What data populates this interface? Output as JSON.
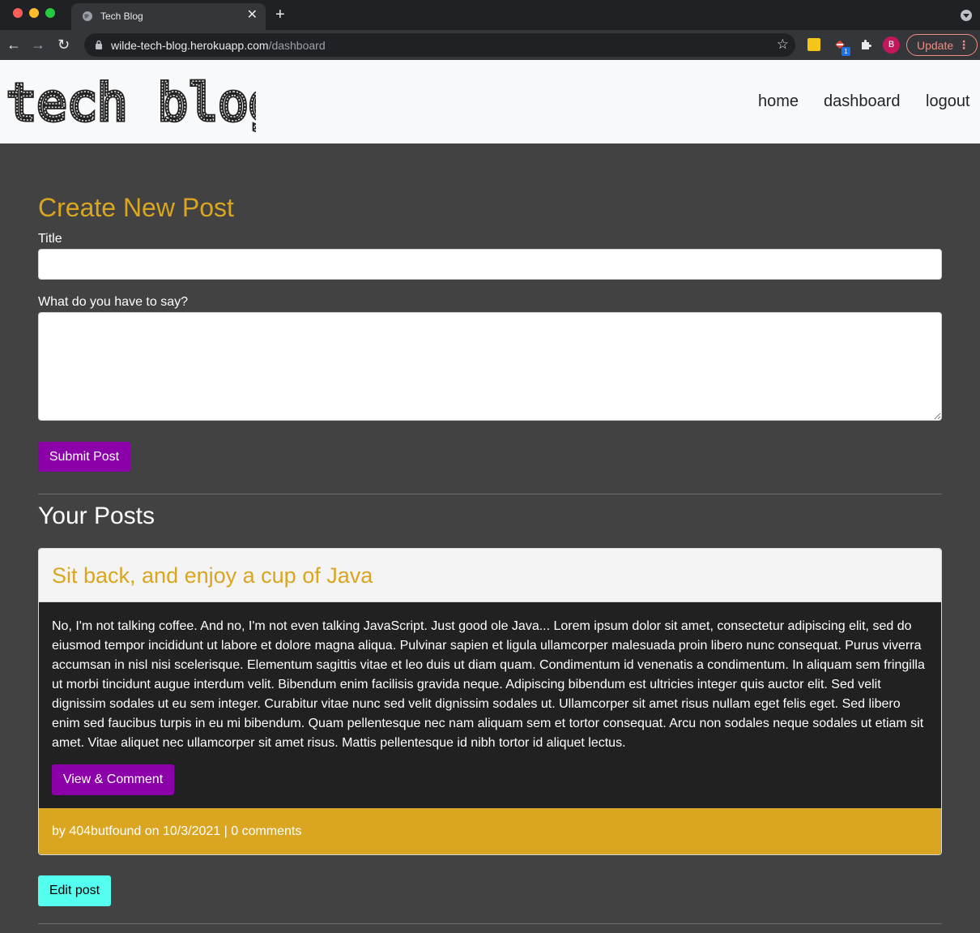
{
  "browser": {
    "tab_title": "Tech Blog",
    "tab_close": "✕",
    "new_tab": "+",
    "url_host": "wilde-tech-blog.herokuapp.com",
    "url_path": "/dashboard",
    "ext_badge": "1",
    "avatar_initial": "B",
    "update_label": "Update",
    "update_more": "⋮",
    "accent_update": "#f28b82"
  },
  "header": {
    "logo_text": "tech blog",
    "nav": {
      "home": "home",
      "dashboard": "dashboard",
      "logout": "logout"
    }
  },
  "create_post": {
    "title": "Create New Post",
    "title_label": "Title",
    "title_value": "",
    "body_label": "What do you have to say?",
    "body_value": "",
    "submit_label": "Submit Post"
  },
  "your_posts": {
    "heading": "Your Posts",
    "posts": [
      {
        "title": "Sit back, and enjoy a cup of Java",
        "body": "No, I'm not talking coffee. And no, I'm not even talking JavaScript. Just good ole Java... Lorem ipsum dolor sit amet, consectetur adipiscing elit, sed do eiusmod tempor incididunt ut labore et dolore magna aliqua. Pulvinar sapien et ligula ullamcorper malesuada proin libero nunc consequat. Purus viverra accumsan in nisl nisi scelerisque. Elementum sagittis vitae et leo duis ut diam quam. Condimentum id venenatis a condimentum. In aliquam sem fringilla ut morbi tincidunt augue interdum velit. Bibendum enim facilisis gravida neque. Adipiscing bibendum est ultricies integer quis auctor elit. Sed velit dignissim sodales ut eu sem integer. Curabitur vitae nunc sed velit dignissim sodales ut. Ullamcorper sit amet risus nullam eget felis eget. Sed libero enim sed faucibus turpis in eu mi bibendum. Quam pellentesque nec nam aliquam sem et tortor consequat. Arcu non sodales neque sodales ut etiam sit amet. Vitae aliquet nec ullamcorper sit amet risus. Mattis pellentesque id nibh tortor id aliquet lectus.",
        "view_label": "View & Comment",
        "footer": "by 404butfound on 10/3/2021 | 0 comments",
        "edit_label": "Edit post"
      }
    ]
  },
  "colors": {
    "gold": "#daa520",
    "purple": "#8b00a8",
    "cyan": "#55fff0",
    "page_bg": "#424242"
  },
  "icons": [
    "globe-icon",
    "back-arrow-icon",
    "forward-arrow-icon",
    "reload-icon",
    "lock-icon",
    "star-icon",
    "puzzle-icon"
  ]
}
